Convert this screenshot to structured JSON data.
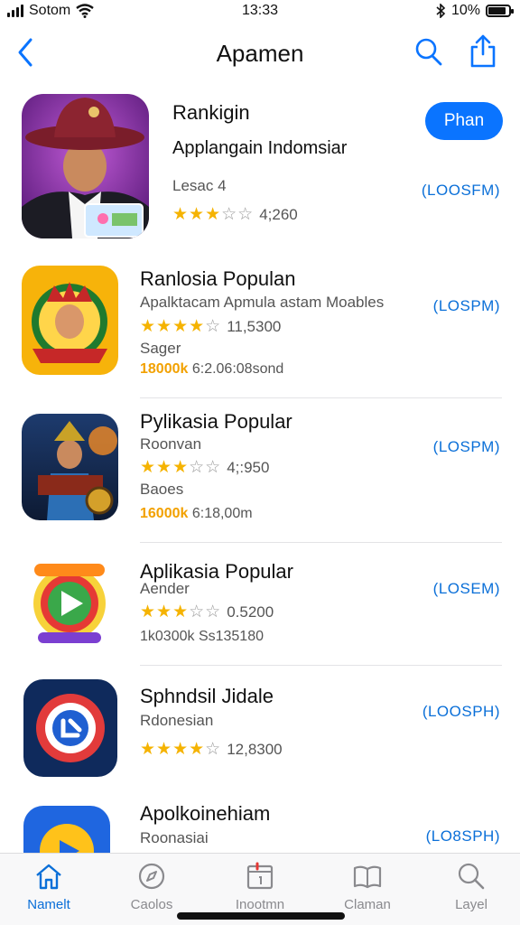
{
  "status_bar": {
    "carrier": "Sotom",
    "time": "13:33",
    "battery": "10%",
    "battery_level": 0.85
  },
  "nav": {
    "title": "Apamen",
    "back_icon": "chevron-left-icon",
    "search_icon": "search-icon",
    "share_icon": "share-icon"
  },
  "apps": [
    {
      "name": "Rankigin",
      "subtitle": "Applangain Indomsiar",
      "meta": "Lesac 4",
      "stars": 3,
      "rating_count": "4;260",
      "get_label": "(LOOSFM)",
      "button_label": "Phan"
    },
    {
      "name": "Ranlosia Populan",
      "subtitle": "Apalktacam Apmula astam Moables",
      "stars": 4,
      "rating_count": "11,5300",
      "meta": "Sager",
      "size_highlight": "18000k",
      "size_rest": "6:2.06:08sond",
      "get_label": "(LOSPM)"
    },
    {
      "name": "Pylikasia Popular",
      "subtitle": "Roonvan",
      "stars": 3,
      "rating_count": "4;:950",
      "meta": "Baoes",
      "size_highlight": "16000k",
      "size_rest": "6:18,00m",
      "get_label": "(LOSPM)"
    },
    {
      "name": "Aplikasia Popular",
      "subtitle": "Aender",
      "stars": 3,
      "rating_count": "0.5200",
      "size_highlight": "",
      "size_rest": "1k0300k  Ss135180",
      "get_label": "(LOSEM)"
    },
    {
      "name": "Sphndsil Jidale",
      "subtitle": "Rdonesian",
      "stars": 4,
      "rating_count": "12,8300",
      "get_label": "(LOOSPH)"
    },
    {
      "name": "Apolkoinehiam",
      "subtitle": "Roonasiai",
      "get_label": "(LO8SPH)"
    }
  ],
  "tabs": [
    {
      "label": "Namelt",
      "icon": "home-icon",
      "active": true
    },
    {
      "label": "Caolos",
      "icon": "compass-icon",
      "active": false
    },
    {
      "label": "Inootmn",
      "icon": "calendar-icon",
      "active": false
    },
    {
      "label": "Claman",
      "icon": "book-icon",
      "active": false
    },
    {
      "label": "Layel",
      "icon": "search-icon",
      "active": false
    }
  ],
  "colors": {
    "accent": "#0a74ff",
    "link": "#0a6fd8",
    "star": "#f5b301",
    "size_highlight": "#f2a100"
  }
}
